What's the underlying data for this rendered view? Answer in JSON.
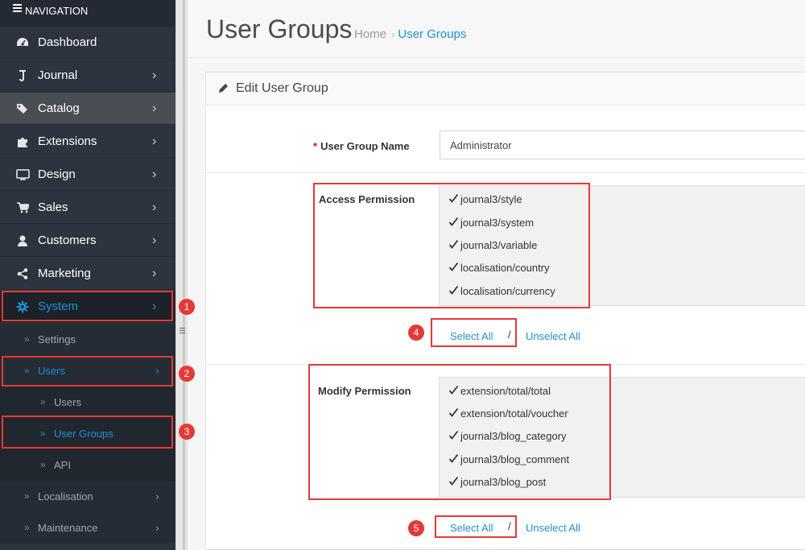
{
  "sidebar": {
    "header_label": "NAVIGATION",
    "menu": [
      {
        "label": "Dashboard",
        "icon": "dashboard-icon",
        "has_children": false
      },
      {
        "label": "Journal",
        "icon": "journal-icon",
        "has_children": true
      },
      {
        "label": "Catalog",
        "icon": "tags-icon",
        "has_children": true
      },
      {
        "label": "Extensions",
        "icon": "puzzle-icon",
        "has_children": true
      },
      {
        "label": "Design",
        "icon": "monitor-icon",
        "has_children": true
      },
      {
        "label": "Sales",
        "icon": "cart-icon",
        "has_children": true
      },
      {
        "label": "Customers",
        "icon": "user-icon",
        "has_children": true
      },
      {
        "label": "Marketing",
        "icon": "share-icon",
        "has_children": true
      },
      {
        "label": "System",
        "icon": "cog-icon",
        "has_children": true,
        "active": true
      }
    ],
    "system_children": [
      {
        "label": "Settings"
      },
      {
        "label": "Users",
        "active": true
      },
      {
        "label": "Users"
      },
      {
        "label": "User Groups",
        "active": true
      },
      {
        "label": "API"
      },
      {
        "label": "Localisation"
      },
      {
        "label": "Maintenance"
      }
    ]
  },
  "header": {
    "title": "User Groups",
    "breadcrumb": {
      "home": "Home",
      "separator": "›",
      "current": "User Groups"
    }
  },
  "panel": {
    "title": "Edit User Group",
    "group_name_label": "User Group Name",
    "required_marker": "*",
    "group_name_value": "Administrator",
    "access_label": "Access Permission",
    "access_items": [
      {
        "label": "journal3/style",
        "checked": true
      },
      {
        "label": "journal3/system",
        "checked": true
      },
      {
        "label": "journal3/variable",
        "checked": true
      },
      {
        "label": "localisation/country",
        "checked": true
      },
      {
        "label": "localisation/currency",
        "checked": true
      }
    ],
    "modify_label": "Modify Permission",
    "modify_items": [
      {
        "label": "extension/total/total",
        "checked": true
      },
      {
        "label": "extension/total/voucher",
        "checked": true
      },
      {
        "label": "journal3/blog_category",
        "checked": true
      },
      {
        "label": "journal3/blog_comment",
        "checked": true
      },
      {
        "label": "journal3/blog_post",
        "checked": true
      }
    ],
    "select_all": "Select All",
    "link_separator": "/",
    "unselect_all": "Unselect All"
  },
  "annotations": {
    "color": "#e53935",
    "steps": [
      "1",
      "2",
      "3",
      "4",
      "5"
    ]
  },
  "colors": {
    "sidebar_bg": "#2c3440",
    "accent": "#1e91cf",
    "highlight": "#e53935"
  }
}
